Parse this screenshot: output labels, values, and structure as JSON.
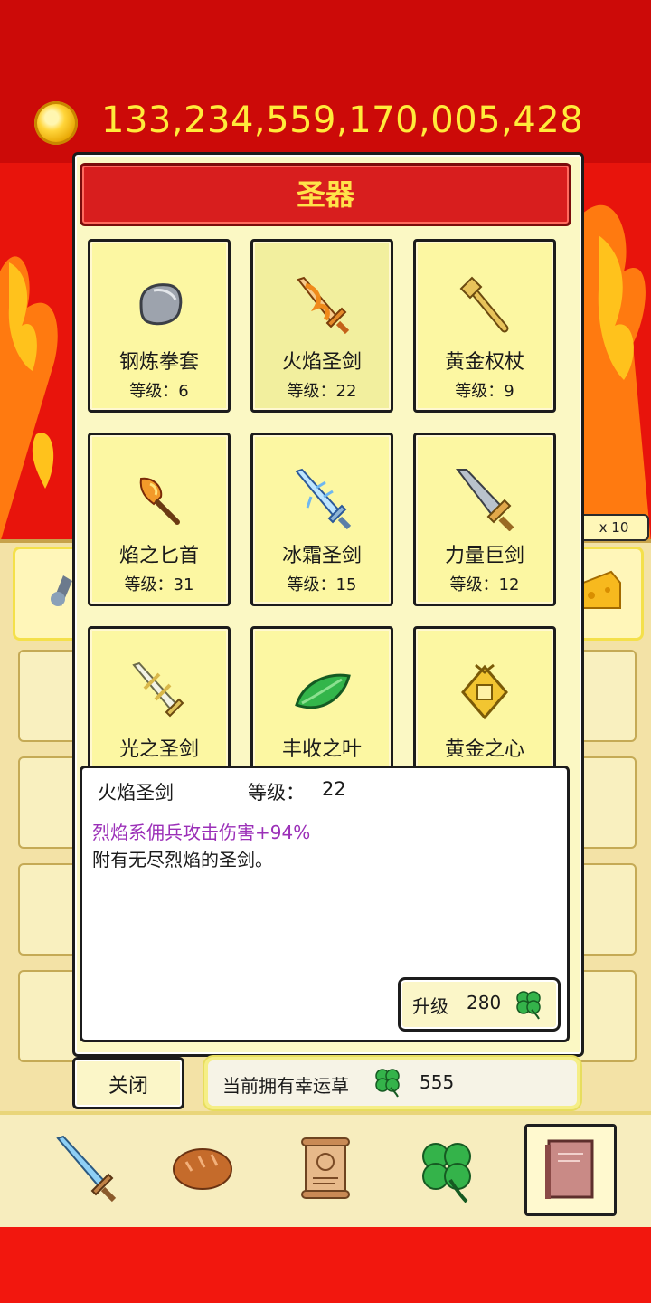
{
  "coins": {
    "amount": "133,234,559,170,005,428",
    "icon": "gold-coin-icon"
  },
  "modal": {
    "title": "圣器",
    "cards": [
      {
        "name": "钢炼拳套",
        "level_label": "等级：",
        "level": "6",
        "icon": "steel-gauntlet-icon"
      },
      {
        "name": "火焰圣剑",
        "level_label": "等级：",
        "level": "22",
        "icon": "flame-holy-sword-icon",
        "selected": true
      },
      {
        "name": "黄金权杖",
        "level_label": "等级：",
        "level": "9",
        "icon": "golden-scepter-icon"
      },
      {
        "name": "焰之匕首",
        "level_label": "等级：",
        "level": "31",
        "icon": "flame-dagger-icon"
      },
      {
        "name": "冰霜圣剑",
        "level_label": "等级：",
        "level": "15",
        "icon": "frost-holy-sword-icon"
      },
      {
        "name": "力量巨剑",
        "level_label": "等级：",
        "level": "12",
        "icon": "power-greatsword-icon"
      },
      {
        "name": "光之圣剑",
        "icon": "light-holy-sword-icon"
      },
      {
        "name": "丰收之叶",
        "icon": "harvest-leaf-icon"
      },
      {
        "name": "黄金之心",
        "icon": "golden-heart-icon"
      }
    ],
    "detail": {
      "name": "火焰圣剑",
      "level_label": "等级：",
      "level": "22",
      "effect": "烈焰系佣兵攻击伤害+94%",
      "description": "附有无尽烈焰的圣剑。"
    },
    "upgrade": {
      "label": "升级",
      "cost": "280",
      "icon": "four-leaf-clover-icon"
    },
    "close_label": "关闭",
    "clover_owned": {
      "label": "当前拥有幸运草",
      "value": "555",
      "icon": "four-leaf-clover-icon"
    }
  },
  "background": {
    "multiplier": "x 10"
  },
  "nav": [
    {
      "icon": "sword-icon"
    },
    {
      "icon": "bread-icon"
    },
    {
      "icon": "scroll-icon"
    },
    {
      "icon": "four-leaf-clover-icon"
    },
    {
      "icon": "book-icon",
      "selected": true
    }
  ],
  "colors": {
    "title_bar": "#d81e1e",
    "title_text": "#ffe34a",
    "card_bg": "#fcf7a2",
    "effect_text": "#9b2fb8"
  }
}
